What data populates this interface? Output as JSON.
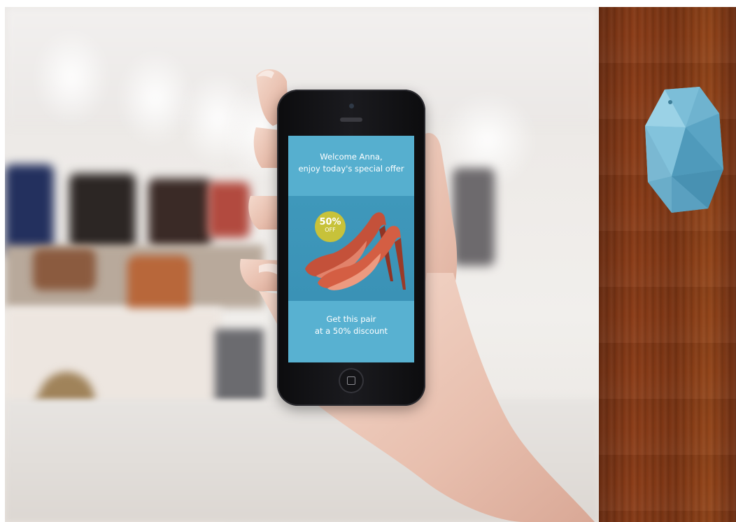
{
  "phone_screen": {
    "welcome_line1": "Welcome Anna,",
    "welcome_line2": "enjoy today's special offer",
    "badge_percent": "50%",
    "badge_off": "OFF",
    "offer_line1": "Get this pair",
    "offer_line2": "at a 50% discount"
  },
  "colors": {
    "screen_blue": "#4aa3c5",
    "badge_yellow": "#c7c23a",
    "beacon_blue": "#6ab3cf",
    "wood": "#8a3c17"
  },
  "icons": [
    "home-button-icon",
    "beacon-device"
  ]
}
